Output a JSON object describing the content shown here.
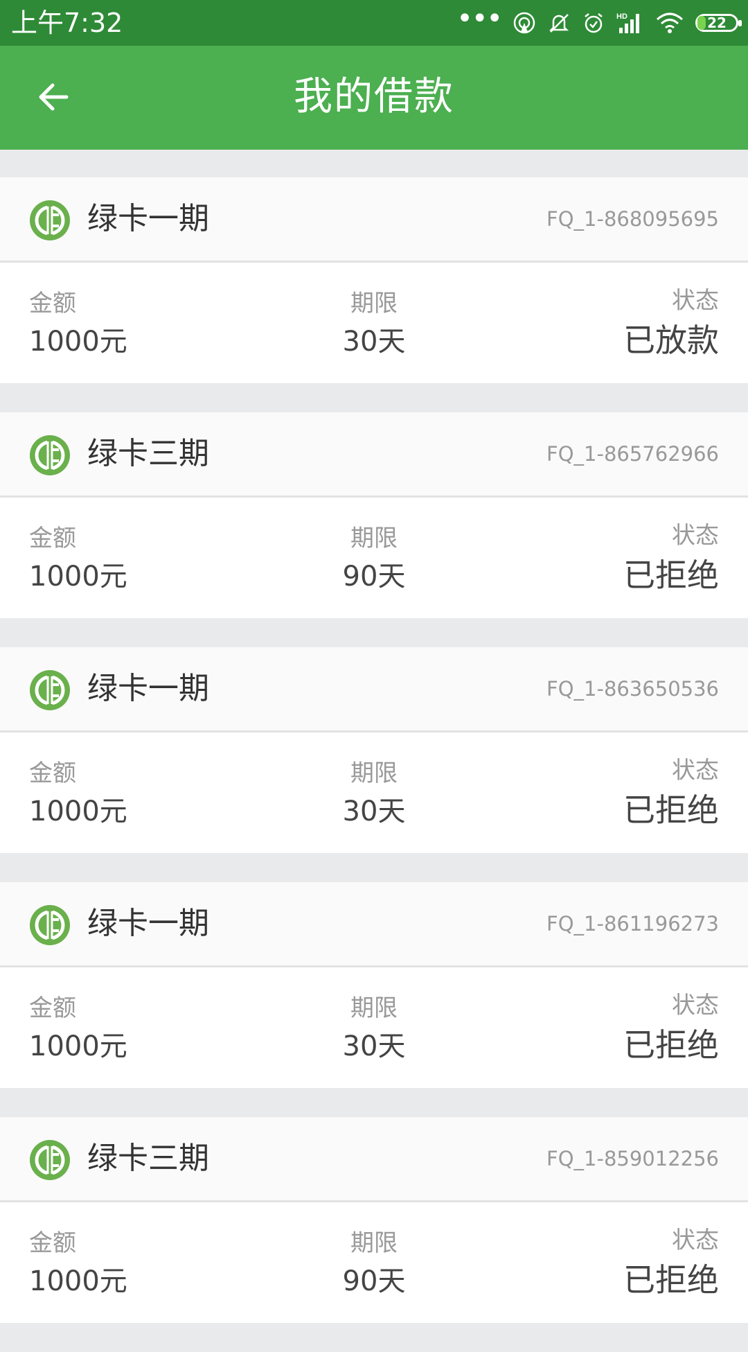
{
  "status_bar": {
    "time": "上午7:32",
    "battery": "22",
    "battery_level": 0.22,
    "icons": [
      "more-dots-icon",
      "hotspot-icon",
      "mute-icon",
      "alarm-icon",
      "hd-signal-icon",
      "wifi-icon",
      "battery-icon"
    ]
  },
  "header": {
    "title": "我的借款",
    "back_icon": "back-arrow-icon"
  },
  "labels": {
    "amount": "金额",
    "term": "期限",
    "status": "状态"
  },
  "loans": [
    {
      "name": "绿卡一期",
      "id": "FQ_1-868095695",
      "amount": "1000元",
      "term": "30天",
      "status": "已放款",
      "status_type": "approved"
    },
    {
      "name": "绿卡三期",
      "id": "FQ_1-865762966",
      "amount": "1000元",
      "term": "90天",
      "status": "已拒绝",
      "status_type": "rejected"
    },
    {
      "name": "绿卡一期",
      "id": "FQ_1-863650536",
      "amount": "1000元",
      "term": "30天",
      "status": "已拒绝",
      "status_type": "rejected"
    },
    {
      "name": "绿卡一期",
      "id": "FQ_1-861196273",
      "amount": "1000元",
      "term": "30天",
      "status": "已拒绝",
      "status_type": "rejected"
    },
    {
      "name": "绿卡三期",
      "id": "FQ_1-859012256",
      "amount": "1000元",
      "term": "90天",
      "status": "已拒绝",
      "status_type": "rejected"
    }
  ],
  "colors": {
    "status_bar": "#2e8a36",
    "app_bar": "#4caf50",
    "approved": "#ef7b1a",
    "logo_green": "#6ab04c"
  }
}
